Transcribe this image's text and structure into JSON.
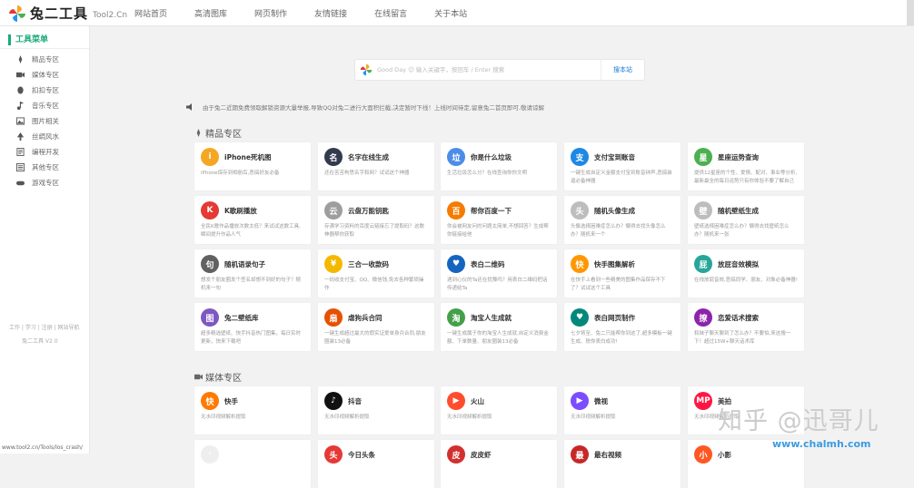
{
  "header": {
    "logo_title": "兔二工具",
    "logo_sub": "Tool2.Cn",
    "nav": [
      "网站首页",
      "高清图库",
      "网页制作",
      "友情链接",
      "在线留言",
      "关于本站"
    ]
  },
  "sidebar": {
    "head": "工具菜单",
    "items": [
      {
        "label": "精品专区",
        "icon": "rocket-icon"
      },
      {
        "label": "媒体专区",
        "icon": "camera-icon"
      },
      {
        "label": "扣扣专区",
        "icon": "qq-penguin-icon"
      },
      {
        "label": "音乐专区",
        "icon": "music-icon"
      },
      {
        "label": "图片相关",
        "icon": "image-icon"
      },
      {
        "label": "丝绸风水",
        "icon": "tree-icon"
      },
      {
        "label": "编程开发",
        "icon": "code-icon"
      },
      {
        "label": "其他专区",
        "icon": "list-icon"
      },
      {
        "label": "游戏专区",
        "icon": "gamepad-icon"
      }
    ],
    "footer_links": "工作 | 学习 | 注册 | 网站导航",
    "footer_version": "兔二工具 V2.0"
  },
  "search": {
    "placeholder": "Good Day ☺ 输入关键字，按回车 / Enter 搜索",
    "button": "搜本站"
  },
  "notice": "由于兔二近期免费领取解锁资源大量举报,导致QQ对兔二进行大面积拦截,决定暂时下线！上线时间待定,留意兔二首页即可.敬请谅解",
  "sections": [
    {
      "title": "精品专区",
      "cards": [
        {
          "icon": "i",
          "color": "#f5a623",
          "title": "iPhone死机图",
          "desc": "iPhone保存到相册后,恶搞好友必备"
        },
        {
          "icon": "名",
          "color": "#333a4d",
          "title": "名字在线生成",
          "desc": "还在苦苦构思名字和网？试试这个神器"
        },
        {
          "icon": "垃",
          "color": "#4b8de8",
          "title": "你是什么垃圾",
          "desc": "生活垃圾怎么分？在线查询你你文明"
        },
        {
          "icon": "支",
          "color": "#1e88e5",
          "title": "支付宝到账音",
          "desc": "一键生成自定义金额支付宝到账音钟声,恶搞装逼必备神器"
        },
        {
          "icon": "星",
          "color": "#4caf50",
          "title": "星座运势查询",
          "desc": "提供12星座的个性、爱情、配对、事业等分析,最新最全的每日运势只有你体验不要了解自己"
        },
        {
          "icon": "K",
          "color": "#e53935",
          "title": "K歌刷播放",
          "desc": "全民K歌作品播放次数太低？来试试这数工具,瞬间提升作品人气"
        },
        {
          "icon": "云",
          "color": "#9e9e9e",
          "title": "云盘万能钥匙",
          "desc": "存满学习资料的百度云链接忘了提取码？这数神器帮你获取"
        },
        {
          "icon": "百",
          "color": "#f57c00",
          "title": "帮你百度一下",
          "desc": "你会被网友问的问题太简单,不想回答？生成帮你链接给他"
        },
        {
          "icon": "头",
          "color": "#bdbdbd",
          "title": "随机头像生成",
          "desc": "头像选择困难症怎么办？懒得去找头像怎么办？随机来一个"
        },
        {
          "icon": "壁",
          "color": "#bdbdbd",
          "title": "随机壁纸生成",
          "desc": "壁纸选择困难症怎么办？懒得去找壁纸怎么办？随机来一张"
        },
        {
          "icon": "句",
          "color": "#616161",
          "title": "随机语录句子",
          "desc": "想发个朋友圈发个签名却想不到好的句子？随机来一句"
        },
        {
          "icon": "¥",
          "color": "#f5b800",
          "title": "三合一收款码",
          "desc": "一码收支付宝、QQ、微信钱,免去各种繁琐操作"
        },
        {
          "icon": "♥",
          "color": "#1565c0",
          "title": "表白二维码",
          "desc": "遇到心仪的Ta还在犹豫吗？用表白二维码把话传递给Ta"
        },
        {
          "icon": "快",
          "color": "#ff9800",
          "title": "快手图集解析",
          "desc": "在快手上看到一些精美的图集作品保存不下了？试试这个工具"
        },
        {
          "icon": "屁",
          "color": "#26a69a",
          "title": "放屁音效模拟",
          "desc": "在线放屁音效,恶搞同学、朋友、对象必备神器!"
        },
        {
          "icon": "图",
          "color": "#7e57c2",
          "title": "兔二壁纸库",
          "desc": "超多精选壁纸、快手抖音热门图集，每日实时更新，快来下载吧"
        },
        {
          "icon": "扇",
          "color": "#e65100",
          "title": "虐狗兵合同",
          "desc": "一键生成超过最大的假实证爱单身兵合同,朋友圈装13必备"
        },
        {
          "icon": "淘",
          "color": "#43a047",
          "title": "淘宝人生成就",
          "desc": "一键生成属于你的淘宝人生成就,自定义消费金额、下单数量、朋友圈装13必备"
        },
        {
          "icon": "♥",
          "color": "#00897b",
          "title": "表白网页制作",
          "desc": "七夕将至、兔二只能帮你到这了,超多模板一键生成、税你表白成功!"
        },
        {
          "icon": "撩",
          "color": "#8e24aa",
          "title": "恋爱话术搜索",
          "desc": "和妹子聊天聊到了怎么办？不要怕,来这搜一下！超过15W+聊天话术库"
        }
      ]
    },
    {
      "title": "媒体专区",
      "cards": [
        {
          "icon": "快",
          "color": "#ff7a00",
          "title": "快手",
          "desc": "无水印视频解析提取"
        },
        {
          "icon": "♪",
          "color": "#111111",
          "title": "抖音",
          "desc": "无水印视频解析提取"
        },
        {
          "icon": "▶",
          "color": "#ff4d2e",
          "title": "火山",
          "desc": "无水印视频解析提取"
        },
        {
          "icon": "▶",
          "color": "#7c4dff",
          "title": "微视",
          "desc": "无水印视频解析提取"
        },
        {
          "icon": "MP",
          "color": "#ff1744",
          "title": "美拍",
          "desc": "无水印视频解析提取"
        }
      ]
    }
  ],
  "partial_row": [
    {
      "icon": "·",
      "color": "#eeeeee",
      "title": ""
    },
    {
      "icon": "头",
      "color": "#e53935",
      "title": "今日头条"
    },
    {
      "icon": "皮",
      "color": "#d32f2f",
      "title": "皮皮虾"
    },
    {
      "icon": "最",
      "color": "#c62828",
      "title": "最右视频"
    },
    {
      "icon": "小",
      "color": "#ff5722",
      "title": "小影"
    }
  ],
  "status_url": "www.tool2.cn/Tools/los_crash/",
  "watermark": "知乎 @迅哥儿",
  "watermark_site": "www.chalmh.com"
}
